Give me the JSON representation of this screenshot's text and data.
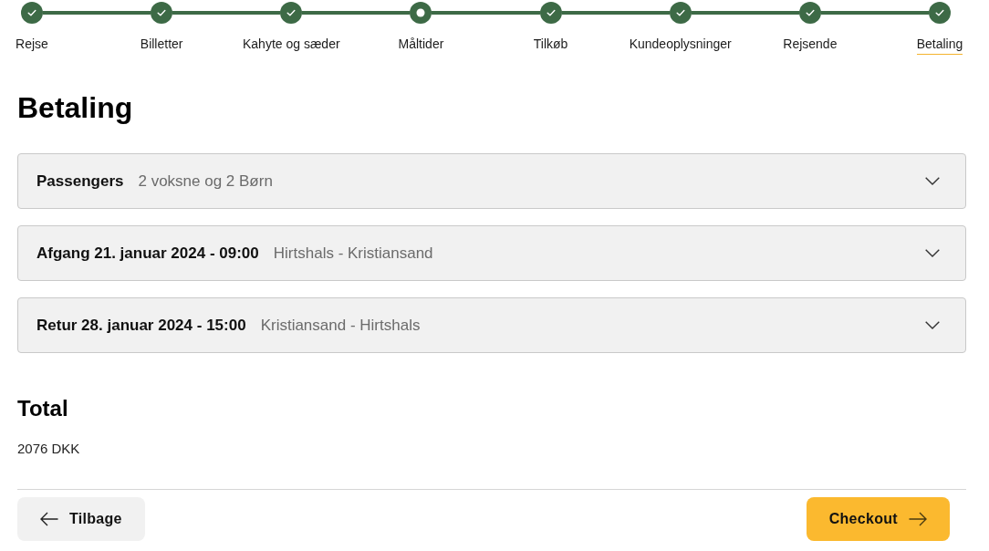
{
  "steps": [
    {
      "label": "Rejse",
      "completed": true,
      "selected": false
    },
    {
      "label": "Billetter",
      "completed": true,
      "selected": false
    },
    {
      "label": "Kahyte og sæder",
      "completed": true,
      "selected": false
    },
    {
      "label": "Måltider",
      "completed": false,
      "selected": false
    },
    {
      "label": "Tilkøb",
      "completed": true,
      "selected": false
    },
    {
      "label": "Kundeoplysninger",
      "completed": true,
      "selected": false
    },
    {
      "label": "Rejsende",
      "completed": true,
      "selected": false
    },
    {
      "label": "Betaling",
      "completed": true,
      "selected": true
    }
  ],
  "page_title": "Betaling",
  "sections": [
    {
      "title": "Passengers",
      "summary": "2 voksne og 2 Børn",
      "expanded": false
    },
    {
      "title": "Afgang 21. januar 2024 - 09:00",
      "summary": "Hirtshals - Kristiansand",
      "expanded": false
    },
    {
      "title": "Retur 28. januar 2024 - 15:00",
      "summary": "Kristiansand - Hirtshals",
      "expanded": false
    }
  ],
  "total": {
    "heading": "Total",
    "amount": "2076 DKK"
  },
  "footer": {
    "back_button": "Tilbage",
    "checkout_button": "Checkout"
  }
}
